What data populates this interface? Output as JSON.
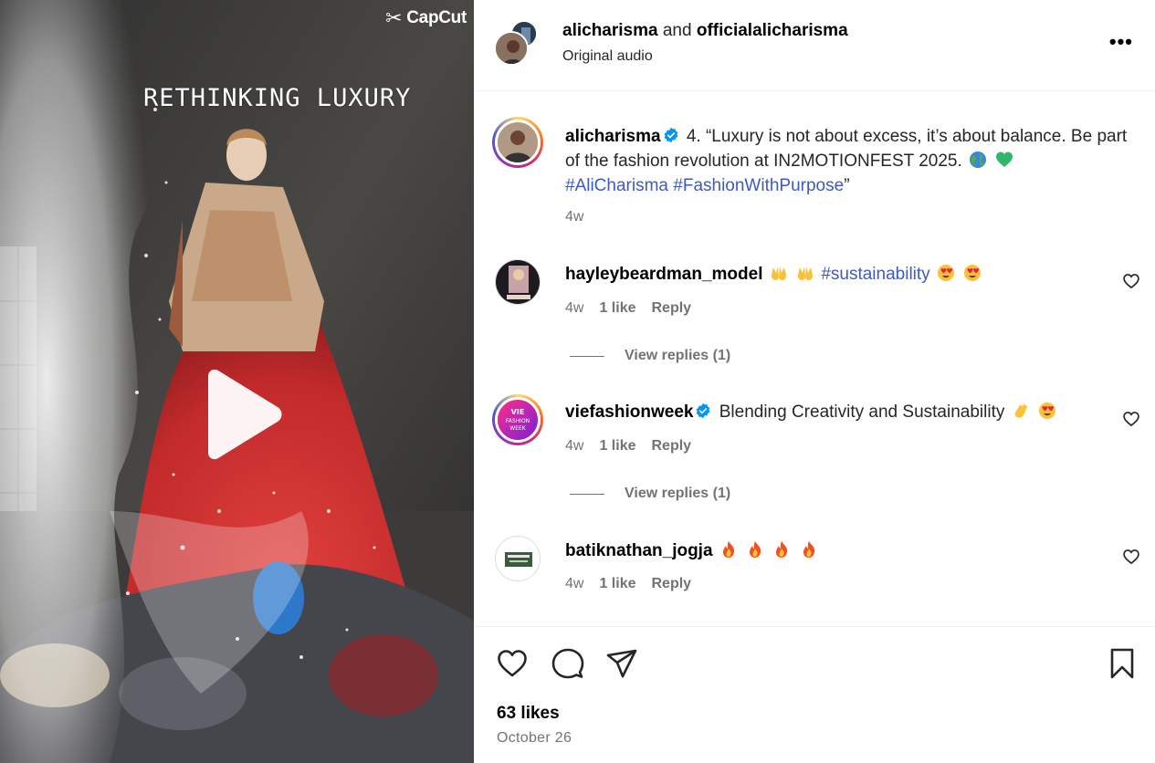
{
  "media": {
    "watermark": "CapCut",
    "title": "RETHINKING LUXURY"
  },
  "header": {
    "user1": "alicharisma",
    "connector": "and",
    "user2": "officialalicharisma",
    "subtitle": "Original audio",
    "more": "•••"
  },
  "caption": {
    "username": "alicharisma",
    "text": "4. “Luxury is not about excess, it’s about balance. Be part of the fashion revolution at IN2MOTIONFEST 2025.",
    "hashtag1": "#AliCharisma",
    "hashtag2": "#FashionWithPurpose",
    "closing_quote": "”",
    "time": "4w"
  },
  "comments": [
    {
      "username": "hayleybeardman_model",
      "hashtag": "#sustainability",
      "time": "4w",
      "likes": "1 like",
      "reply": "Reply",
      "view_replies": "View replies (1)"
    },
    {
      "username": "viefashionweek",
      "text": "Blending Creativity and Sustainability",
      "avatar_text": "VIE FASHION WEEK",
      "time": "4w",
      "likes": "1 like",
      "reply": "Reply",
      "view_replies": "View replies (1)"
    },
    {
      "username": "batiknathan_jogja",
      "time": "4w",
      "likes": "1 like",
      "reply": "Reply"
    }
  ],
  "footer": {
    "likes": "63 likes",
    "date": "October 26"
  },
  "colors": {
    "hashtag": "#3b5ac8",
    "verified": "#0095f6",
    "muted": "#737373"
  }
}
